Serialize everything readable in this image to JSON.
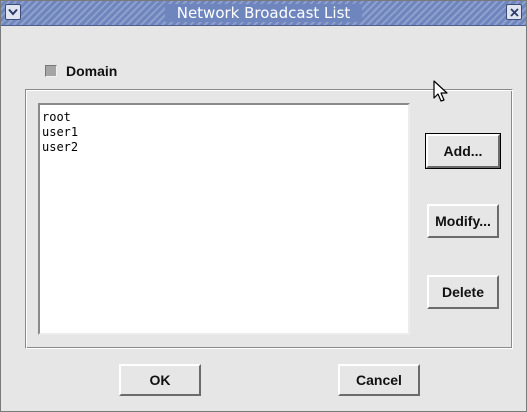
{
  "window": {
    "title": "Network Broadcast List",
    "titlebar_color": "#6e85be"
  },
  "controls": {
    "window_menu_icon": "chevron-down-icon",
    "close_icon": "close-icon"
  },
  "domain": {
    "label": "Domain",
    "checked": false
  },
  "list": {
    "items": [
      "root",
      "user1",
      "user2"
    ]
  },
  "buttons": {
    "add": "Add...",
    "modify": "Modify...",
    "delete": "Delete",
    "ok": "OK",
    "cancel": "Cancel"
  }
}
